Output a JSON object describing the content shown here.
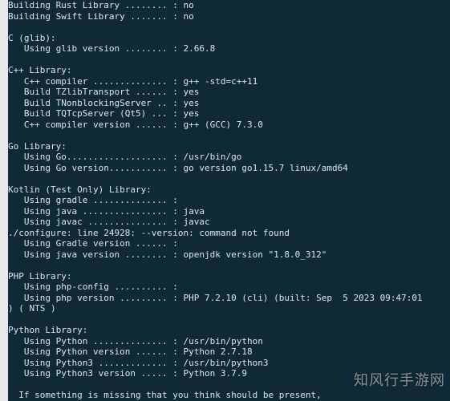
{
  "terminal": {
    "lines": [
      "Building Rust Library ........ : no",
      "Building Swift Library ....... : no",
      "",
      "C (glib):",
      "   Using glib version ........ : 2.66.8",
      "",
      "C++ Library:",
      "   C++ compiler .............. : g++ -std=c++11",
      "   Build TZlibTransport ...... : yes",
      "   Build TNonblockingServer .. : yes",
      "   Build TQTcpServer (Qt5) ... : yes",
      "   C++ compiler version ...... : g++ (GCC) 7.3.0",
      "",
      "Go Library:",
      "   Using Go................... : /usr/bin/go",
      "   Using Go version........... : go version go1.15.7 linux/amd64",
      "",
      "Kotlin (Test Only) Library:",
      "   Using gradle .............. :",
      "   Using java ................ : java",
      "   Using javac ............... : javac",
      "./configure: line 24928: --version: command not found",
      "   Using Gradle version ...... :",
      "   Using java version ........ : openjdk version \"1.8.0_312\"",
      "",
      "PHP Library:",
      "   Using php-config .......... :",
      "   Using php version ......... : PHP 7.2.10 (cli) (built: Sep  5 2023 09:47:01",
      ") ( NTS )",
      "",
      "Python Library:",
      "   Using Python .............. : /usr/bin/python",
      "   Using Python version ...... : Python 2.7.18",
      "   Using Python3 ............. : /usr/bin/python3",
      "   Using Python3 version ..... : Python 3.7.9",
      "",
      "  If something is missing that you think should be present,"
    ]
  },
  "watermark": {
    "text": "知风行手游网"
  }
}
